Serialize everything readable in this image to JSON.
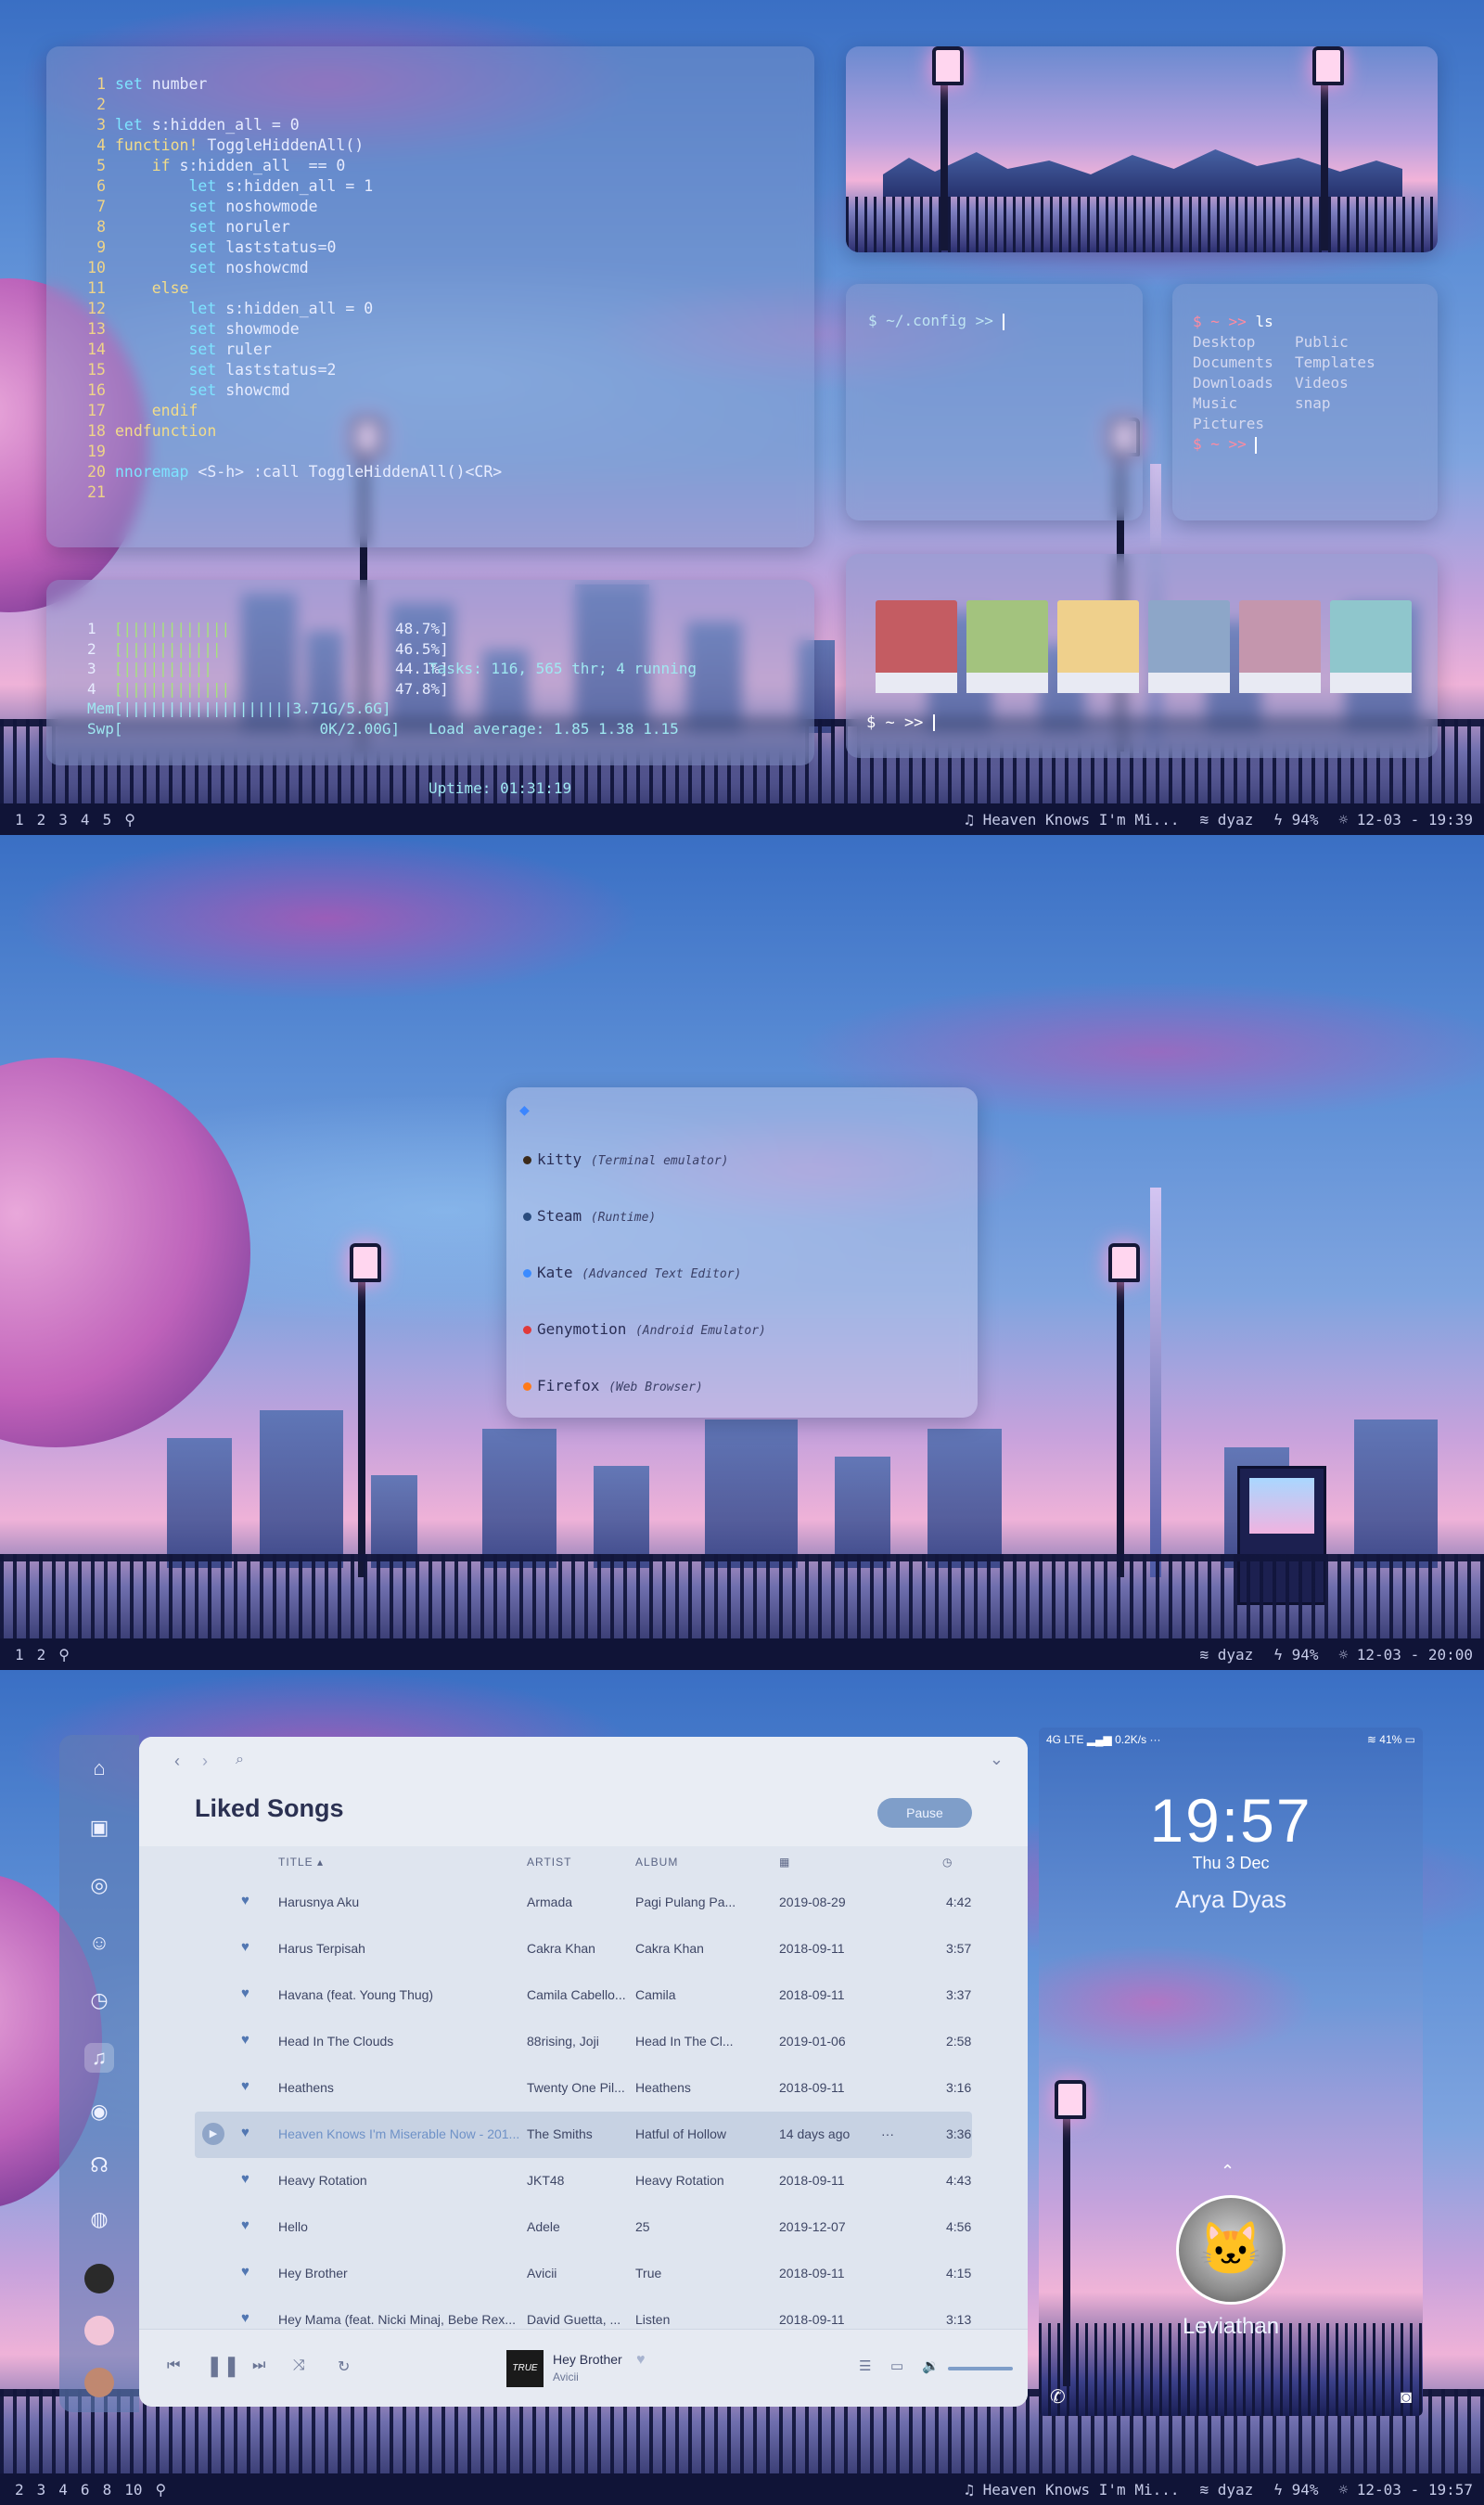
{
  "screens": {
    "top": {
      "vim_lines": [
        {
          "n": "1",
          "code": "set number"
        },
        {
          "n": "2",
          "code": ""
        },
        {
          "n": "3",
          "code": "let s:hidden_all = 0"
        },
        {
          "n": "4",
          "code": "function! ToggleHiddenAll()"
        },
        {
          "n": "5",
          "code": "    if s:hidden_all  == 0"
        },
        {
          "n": "6",
          "code": "        let s:hidden_all = 1"
        },
        {
          "n": "7",
          "code": "        set noshowmode"
        },
        {
          "n": "8",
          "code": "        set noruler"
        },
        {
          "n": "9",
          "code": "        set laststatus=0"
        },
        {
          "n": "10",
          "code": "        set noshowcmd"
        },
        {
          "n": "11",
          "code": "    else"
        },
        {
          "n": "12",
          "code": "        let s:hidden_all = 0"
        },
        {
          "n": "13",
          "code": "        set showmode"
        },
        {
          "n": "14",
          "code": "        set ruler"
        },
        {
          "n": "15",
          "code": "        set laststatus=2"
        },
        {
          "n": "16",
          "code": "        set showcmd"
        },
        {
          "n": "17",
          "code": "    endif"
        },
        {
          "n": "18",
          "code": "endfunction"
        },
        {
          "n": "19",
          "code": ""
        },
        {
          "n": "20",
          "code": "nnoremap <S-h> :call ToggleHiddenAll()<CR>"
        },
        {
          "n": "21",
          "code": ""
        }
      ],
      "htop": {
        "cpu_rows": [
          {
            "label": "1",
            "bars": "[||||||||||||",
            "value": "48.7%]"
          },
          {
            "label": "2",
            "bars": "[|||||||||||",
            "value": "46.5%]"
          },
          {
            "label": "3",
            "bars": "[||||||||||",
            "value": "44.1%]"
          },
          {
            "label": "4",
            "bars": "[||||||||||||",
            "value": "47.8%]"
          }
        ],
        "mem": "Mem[|||||||||||||||||||3.71G/5.6G]",
        "swp": "Swp[                      0K/2.00G]",
        "tasks": "Tasks: 116, 565 thr; 4 running",
        "load": "Load average: 1.85 1.38 1.15",
        "uptime": "Uptime: 01:31:19"
      },
      "term1": {
        "prompt": "$ ~/.config >> "
      },
      "term2": {
        "prompt1": "$ ~ >>",
        "cmd": "ls",
        "ls": [
          "Desktop",
          "Public",
          "Documents",
          "Templates",
          "Downloads",
          "Videos",
          "Music",
          "snap",
          "Pictures",
          ""
        ],
        "prompt2": "$ ~ >>"
      },
      "palette": {
        "colors": [
          "#c45c62",
          "#a3c37e",
          "#efd08c",
          "#8da6c8",
          "#c496ad",
          "#8fc6cc"
        ],
        "prompt": "$ ~ >> "
      },
      "bar": {
        "workspaces": [
          "1",
          "2",
          "3",
          "4",
          "5"
        ],
        "music": "♫ Heaven Knows I'm Mi...",
        "wifi": "dyaz",
        "battery": "94%",
        "datetime": "12-03 - 19:39"
      }
    },
    "middle": {
      "launcher": {
        "items": [
          {
            "name": "kitty",
            "desc": "(Terminal emulator)",
            "color": "#3b2a1a"
          },
          {
            "name": "Steam",
            "desc": "(Runtime)",
            "color": "#2b4c7e"
          },
          {
            "name": "Kate",
            "desc": "(Advanced Text Editor)",
            "color": "#3b8bff"
          },
          {
            "name": "Genymotion",
            "desc": "(Android Emulator)",
            "color": "#e03a3a"
          },
          {
            "name": "Firefox",
            "desc": "(Web Browser)",
            "color": "#ff7a1a"
          }
        ]
      },
      "bar": {
        "workspaces": [
          "1",
          "2"
        ],
        "wifi": "dyaz",
        "battery": "94%",
        "datetime": "12-03 - 20:00"
      }
    },
    "bottom": {
      "spotify": {
        "title": "Liked Songs",
        "pause_label": "Pause",
        "headers": {
          "title": "TITLE",
          "artist": "ARTIST",
          "album": "ALBUM"
        },
        "tracks": [
          {
            "title": "Harusnya Aku",
            "artist": "Armada",
            "album": "Pagi Pulang Pa...",
            "date": "2019-08-29",
            "dur": "4:42"
          },
          {
            "title": "Harus Terpisah",
            "artist": "Cakra Khan",
            "album": "Cakra Khan",
            "date": "2018-09-11",
            "dur": "3:57"
          },
          {
            "title": "Havana (feat. Young Thug)",
            "artist": "Camila Cabello...",
            "album": "Camila",
            "date": "2018-09-11",
            "dur": "3:37"
          },
          {
            "title": "Head In The Clouds",
            "artist": "88rising, Joji",
            "album": "Head In The Cl...",
            "date": "2019-01-06",
            "dur": "2:58"
          },
          {
            "title": "Heathens",
            "artist": "Twenty One Pil...",
            "album": "Heathens",
            "date": "2018-09-11",
            "dur": "3:16"
          },
          {
            "title": "Heaven Knows I'm Miserable Now - 201...",
            "artist": "The Smiths",
            "album": "Hatful of Hollow",
            "date": "14 days ago",
            "dur": "3:36",
            "playing": true
          },
          {
            "title": "Heavy Rotation",
            "artist": "JKT48",
            "album": "Heavy Rotation",
            "date": "2018-09-11",
            "dur": "4:43"
          },
          {
            "title": "Hello",
            "artist": "Adele",
            "album": "25",
            "date": "2019-12-07",
            "dur": "4:56"
          },
          {
            "title": "Hey Brother",
            "artist": "Avicii",
            "album": "True",
            "date": "2018-09-11",
            "dur": "4:15"
          },
          {
            "title": "Hey Mama (feat. Nicki Minaj, Bebe Rex...",
            "artist": "David Guetta, ...",
            "album": "Listen",
            "date": "2018-09-11",
            "dur": "3:13"
          }
        ],
        "now_playing": {
          "title": "Hey Brother",
          "artist": "Avicii",
          "cover_text": "TRUE"
        }
      },
      "phone": {
        "network": "4G LTE",
        "speed": "0.2K/s",
        "battery": "41%",
        "time": "19:57",
        "date": "Thu 3 Dec",
        "owner": "Arya Dyas",
        "user": "Leviathan"
      },
      "bar": {
        "workspaces": [
          "2",
          "3",
          "4",
          "6",
          "8",
          "10"
        ],
        "music": "♫ Heaven Knows I'm Mi...",
        "wifi": "dyaz",
        "battery": "94%",
        "datetime": "12-03 - 19:57"
      }
    }
  }
}
